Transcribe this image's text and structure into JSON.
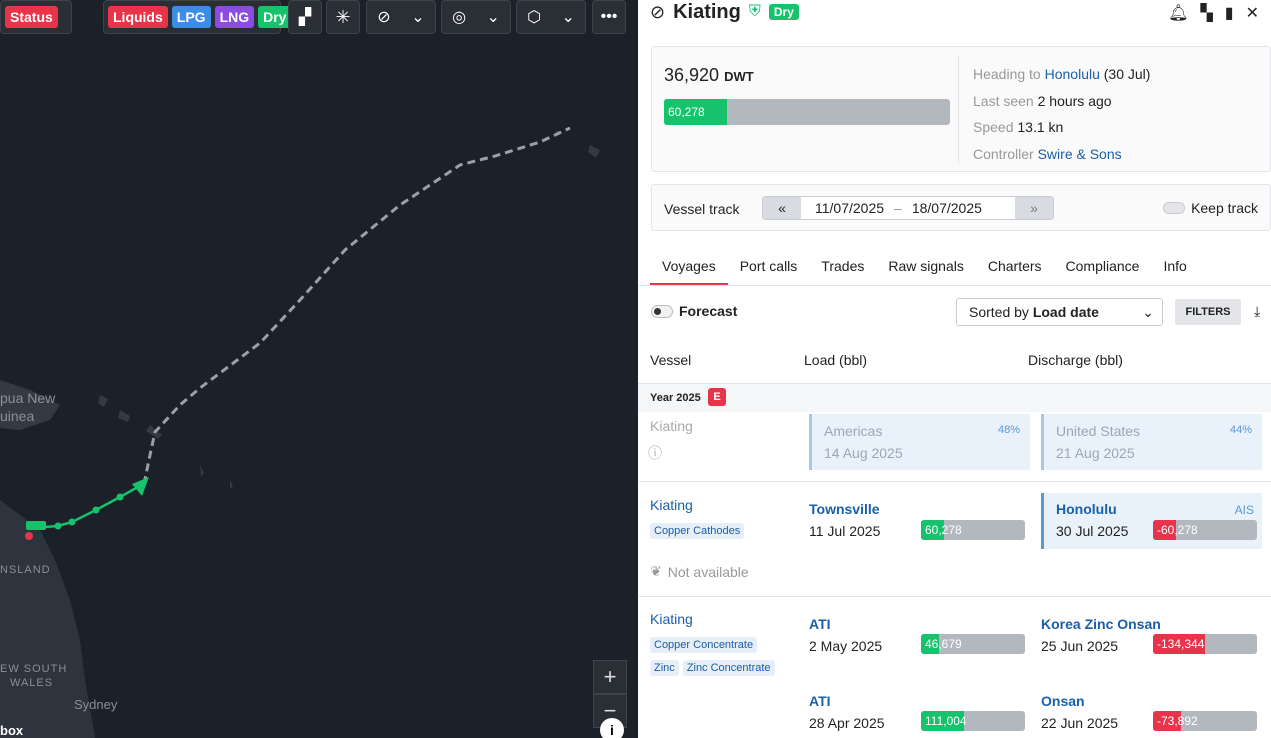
{
  "map": {
    "toolbar": {
      "status": "Status",
      "liquids": "Liquids",
      "lpg": "LPG",
      "lng": "LNG",
      "dry": "Dry"
    },
    "labels": {
      "png1": "pua New",
      "png2": "uinea",
      "qld": "NSLAND",
      "nsw1": "EW SOUTH",
      "nsw2": "WALES",
      "sydney": "Sydney",
      "mapbox": "box"
    },
    "zoom_in": "+",
    "zoom_out": "−",
    "info": "i"
  },
  "vessel": {
    "name": "Kiating",
    "type_badge": "Dry"
  },
  "summary": {
    "dwt_value": "36,920",
    "dwt_unit": "DWT",
    "cargo_bar_label": "60,278",
    "cargo_fill_fraction": 0.22,
    "heading_label": "Heading to",
    "heading_port": "Honolulu",
    "heading_date": "(30 Jul)",
    "last_seen_label": "Last seen",
    "last_seen_value": "2 hours ago",
    "speed_label": "Speed",
    "speed_value": "13.1 kn",
    "controller_label": "Controller",
    "controller_value": "Swire & Sons"
  },
  "track": {
    "label": "Vessel track",
    "from": "11/07/2025",
    "dash": "–",
    "to": "18/07/2025",
    "keep_label": "Keep track"
  },
  "tabs": [
    "Voyages",
    "Port calls",
    "Trades",
    "Raw signals",
    "Charters",
    "Compliance",
    "Info"
  ],
  "controls": {
    "forecast": "Forecast",
    "sort_prefix": "Sorted by",
    "sort_value": "Load date",
    "filters": "FILTERS"
  },
  "columns": {
    "vessel": "Vessel",
    "load": "Load (bbl)",
    "discharge": "Discharge (bbl)"
  },
  "year": {
    "label": "Year 2025",
    "badge": "E"
  },
  "forecast_row": {
    "vessel": "Kiating",
    "load_region": "Americas",
    "load_pct": "48%",
    "load_date": "14 Aug 2025",
    "dis_region": "United States",
    "dis_pct": "44%",
    "dis_date": "21 Aug 2025"
  },
  "voyage1": {
    "vessel": "Kiating",
    "cargo": "Copper Cathodes",
    "load_port": "Townsville",
    "load_date": "11 Jul 2025",
    "load_qty": "60,278",
    "load_fill": 0.22,
    "dis_port": "Honolulu",
    "dis_tag": "AIS",
    "dis_date": "30 Jul 2025",
    "dis_qty": "-60,278",
    "dis_fill": 0.22,
    "emissions": "Not available"
  },
  "voyage2": {
    "vessel": "Kiating",
    "cargo1": "Copper Concentrate",
    "cargo2": "Zinc",
    "cargo3": "Zinc Concentrate",
    "legs": [
      {
        "load_port": "ATI",
        "load_date": "2 May 2025",
        "load_qty": "46,679",
        "load_fill": 0.17,
        "dis_port": "Korea Zinc Onsan",
        "dis_date": "25 Jun 2025",
        "dis_qty": "-134,344",
        "dis_fill": 0.5
      },
      {
        "load_port": "ATI",
        "load_date": "28 Apr 2025",
        "load_qty": "111,004",
        "load_fill": 0.41,
        "dis_port": "Onsan",
        "dis_date": "22 Jun 2025",
        "dis_qty": "-73,892",
        "dis_fill": 0.27
      }
    ]
  },
  "colors": {
    "accent_red": "#e8344a",
    "green": "#16c26b",
    "link_blue": "#1a5fa8",
    "map_bg": "#1c2129"
  }
}
